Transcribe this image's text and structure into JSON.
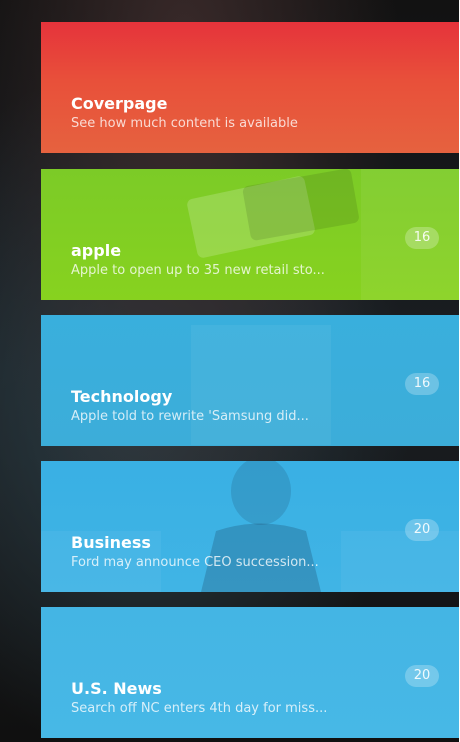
{
  "colors": {
    "coverpage": "#e6453a",
    "apple": "#82cf24",
    "technology": "#3db6e4",
    "business": "#3ab2e4",
    "us_news": "#46b7e5"
  },
  "sections": [
    {
      "title": "Coverpage",
      "subtitle": "See how much content is available"
    },
    {
      "title": "apple",
      "subtitle": "Apple to open up to 35 new retail sto...",
      "count": "16"
    },
    {
      "title": "Technology",
      "subtitle": "Apple told to rewrite 'Samsung did...",
      "count": "16"
    },
    {
      "title": "Business",
      "subtitle": "Ford may announce CEO succession...",
      "count": "20"
    },
    {
      "title": "U.S. News",
      "subtitle": "Search off NC enters 4th day for miss...",
      "count": "20"
    }
  ]
}
